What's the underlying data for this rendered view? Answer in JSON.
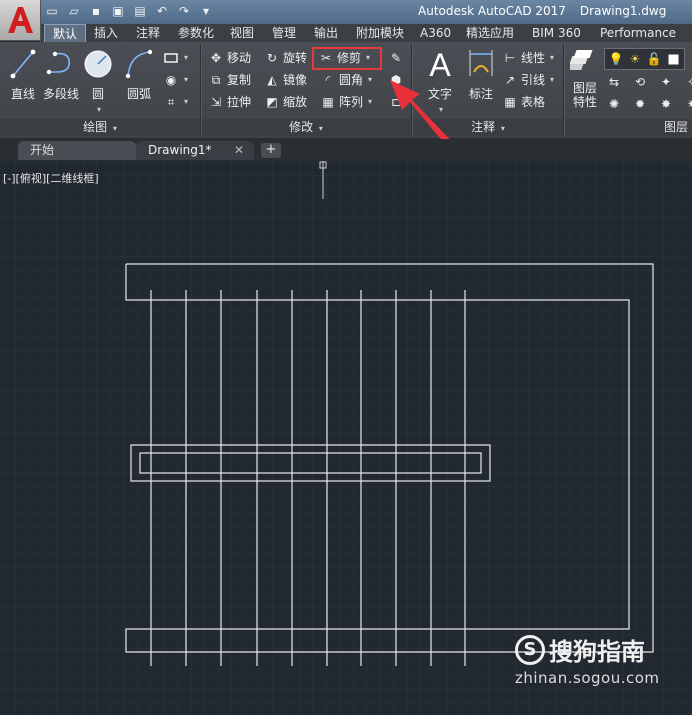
{
  "window": {
    "app_title": "Autodesk AutoCAD 2017",
    "file_title": "Drawing1.dwg",
    "app_logo": "A"
  },
  "quick_access": [
    "new-icon",
    "open-icon",
    "save-icon",
    "save-as-icon",
    "print-icon",
    "undo-icon",
    "redo-icon",
    "dropdown-icon"
  ],
  "ribbon_tabs": [
    {
      "label": "默认",
      "active": true
    },
    {
      "label": "插入"
    },
    {
      "label": "注释"
    },
    {
      "label": "参数化"
    },
    {
      "label": "视图"
    },
    {
      "label": "管理"
    },
    {
      "label": "输出"
    },
    {
      "label": "附加模块"
    },
    {
      "label": "A360"
    },
    {
      "label": "精选应用"
    },
    {
      "label": "BIM 360"
    },
    {
      "label": "Performance"
    }
  ],
  "draw_panel": {
    "title": "绘图",
    "tools": {
      "line": "直线",
      "polyline": "多段线",
      "circle": "圆",
      "arc": "圆弧"
    }
  },
  "modify_panel": {
    "title": "修改",
    "tools": {
      "move": "移动",
      "rotate": "旋转",
      "trim": "修剪",
      "copy": "复制",
      "mirror": "镜像",
      "fillet": "圆角",
      "stretch": "拉伸",
      "scale": "缩放",
      "array": "阵列"
    }
  },
  "annotation_panel": {
    "title": "注释",
    "tools": {
      "text": "文字",
      "dimension": "标注",
      "linear": "线性",
      "leader": "引线",
      "table": "表格"
    }
  },
  "layers_panel": {
    "title": "图层",
    "tools": {
      "layer_properties_line1": "图层",
      "layer_properties_line2": "特性"
    }
  },
  "doc_tabs": [
    {
      "label": "开始"
    },
    {
      "label": "Drawing1*",
      "active": true
    }
  ],
  "viewport_label": "[-][俯视][二维线框]",
  "watermark": {
    "text": "搜狗指南",
    "url": "zhinan.sogou.com",
    "logo": "S"
  },
  "colors": {
    "canvas": "#212830",
    "highlight": "#e33b3b",
    "logo_red": "#d11f1f",
    "drawing_lines": "#e8e8e8"
  }
}
